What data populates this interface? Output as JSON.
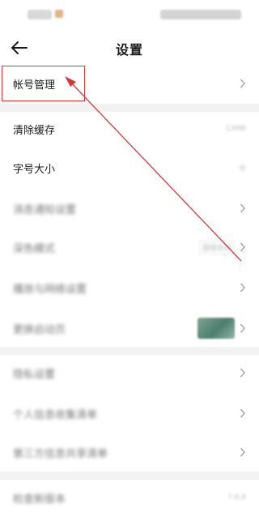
{
  "status_bar": {},
  "header": {
    "title": "设置"
  },
  "rows": [
    {
      "label": "帐号管理",
      "value": ""
    },
    {
      "label": "清除缓存",
      "value": "13MB"
    },
    {
      "label": "字号大小",
      "value": "中"
    },
    {
      "label": "消息通知设置",
      "value": ""
    },
    {
      "label": "深色模式",
      "value": "跟随系统"
    },
    {
      "label": "播放与网络设置",
      "value": ""
    },
    {
      "label": "更换启动页",
      "value": ""
    },
    {
      "label": "隐私设置",
      "value": ""
    },
    {
      "label": "个人信息收集清单",
      "value": ""
    },
    {
      "label": "第三方信息共享清单",
      "value": ""
    },
    {
      "label": "检查新版本",
      "value": "7.0.8"
    }
  ],
  "icons": {
    "back": "arrow-left-icon",
    "chevron": "chevron-right-icon"
  },
  "colors": {
    "annotation": "#d23a3a",
    "divider": "#f2f2f2",
    "text": "#1a1a1a"
  }
}
